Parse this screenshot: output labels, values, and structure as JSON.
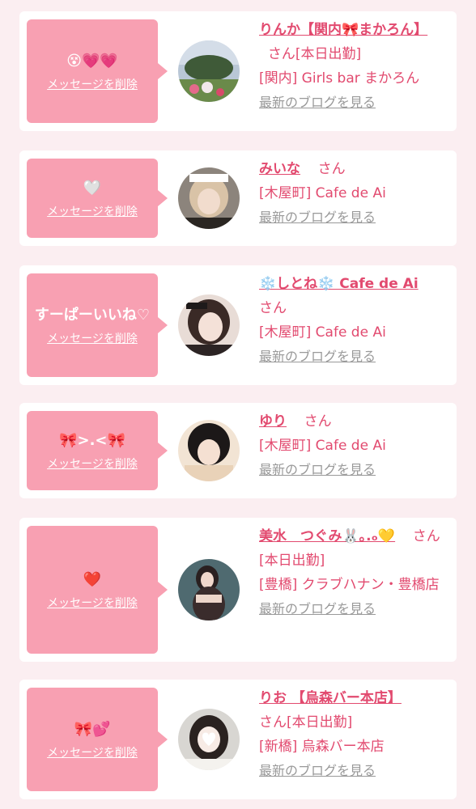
{
  "delete_label": "メッセージを削除",
  "blog_label": "最新のブログを見る",
  "san_label": "さん",
  "colors": {
    "accent": "#e24a6f",
    "bubble": "#f8a0b2",
    "background": "#fbeef1",
    "link_gray": "#999999"
  },
  "cards": [
    {
      "message": "😵💗💗",
      "name": "りんか【関内🎀まかろん】",
      "status": "[本日出勤]",
      "shop": "[関内] Girls bar まかろん"
    },
    {
      "message": "🤍",
      "name": "みいな",
      "status": "",
      "shop": "[木屋町] Cafe de Ai"
    },
    {
      "message": "すーぱーいいね♡",
      "name": "❄️しとね❄️ Cafe de Ai",
      "status": "",
      "shop": "[木屋町] Cafe de Ai"
    },
    {
      "message": "🎀>.<🎀",
      "name": "ゆり",
      "status": "",
      "shop": "[木屋町] Cafe de Ai"
    },
    {
      "message": "❤️",
      "name": "美水　つぐみ🐰｡.ₒ💛",
      "status": "[本日出勤]",
      "shop": "[豊橋] クラブハナン・豊橋店"
    },
    {
      "message": "🎀💕",
      "name": "りお 【烏森バー本店】",
      "status": "[本日出勤]",
      "shop": "[新橋] 烏森バー本店"
    }
  ]
}
